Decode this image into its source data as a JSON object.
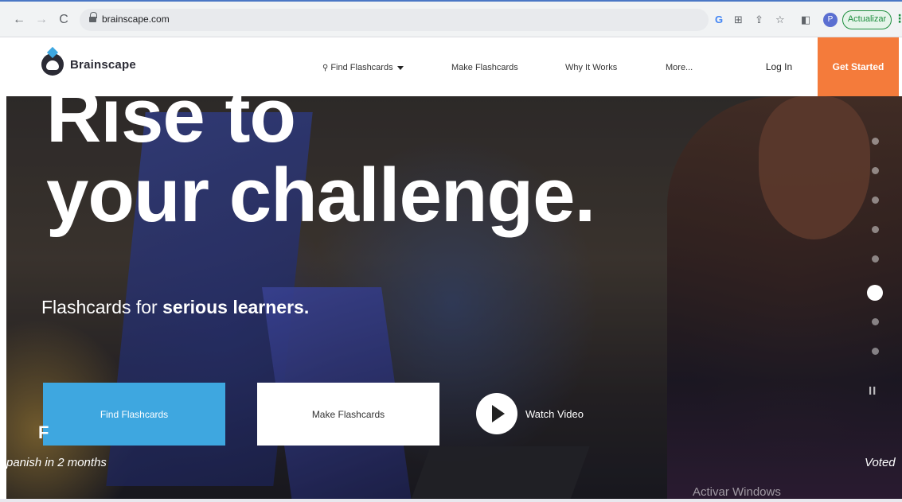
{
  "browser": {
    "back_glyph": "←",
    "forward_glyph": "→",
    "reload_glyph": "C",
    "url": "brainscape.com",
    "extensions": [
      "G",
      "⊞",
      "⇪",
      "☆",
      "◧"
    ],
    "profile_initial": "P",
    "update_label": "Actualizar",
    "menu_glyph": "⋮",
    "accent_color": "#1e8e3e"
  },
  "header": {
    "logo_text": "Brainscape",
    "nav": {
      "find_flashcards": "Find Flashcards",
      "make_flashcards": "Make Flashcards",
      "why_it_works": "Why It Works",
      "more": "More..."
    },
    "login": "Log In",
    "get_started": "Get Started",
    "brand_orange": "#f47b3b"
  },
  "hero": {
    "headline_line1": "Rise to",
    "headline_line2": "your challenge.",
    "subhead_prefix": "Flashcards for ",
    "subhead_bold": "serious learners.",
    "find_button": "Find Flashcards",
    "make_button": "Make Flashcards",
    "watch_video": "Watch Video",
    "testimonial_left": "panish in 2 months",
    "testimonial_left_initial": "F",
    "testimonial_right": "Voted",
    "watermark": "Activar Windows",
    "pause_glyph": "II",
    "brand_blue": "#3ea7e0",
    "slide_count": 8,
    "active_slide": 5
  }
}
